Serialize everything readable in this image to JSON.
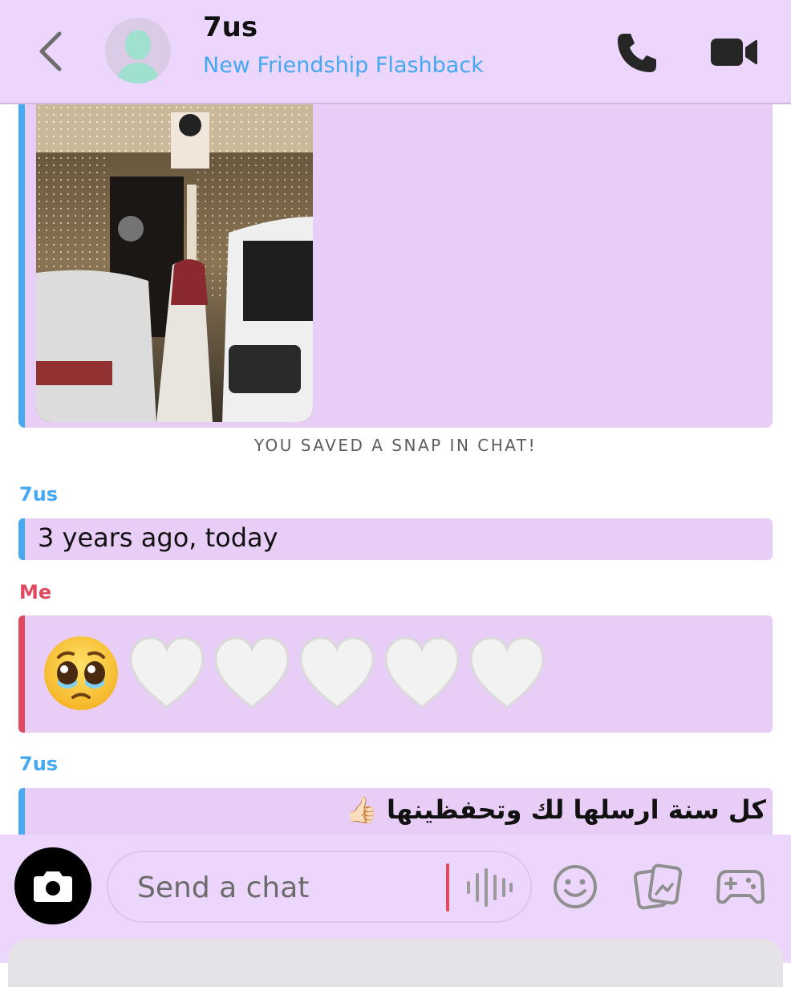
{
  "header": {
    "contact_name": "7us",
    "subtitle": "New Friendship Flashback"
  },
  "chat": {
    "saved_notice": "YOU SAVED A SNAP IN CHAT!",
    "messages": [
      {
        "sender": "7us",
        "text": "3 years ago, today"
      },
      {
        "sender": "Me",
        "text": "🥹🤍🤍🤍🤍🤍"
      },
      {
        "sender": "7us",
        "text": "كل سنة ارسلها لك وتحفظينها 👍🏻"
      }
    ]
  },
  "composer": {
    "placeholder": "Send a chat"
  },
  "colors": {
    "accent_blue": "#45a9f4",
    "accent_red": "#e0495f",
    "bubble": "#e8cdf7",
    "header_bg": "#ecd6fb"
  }
}
